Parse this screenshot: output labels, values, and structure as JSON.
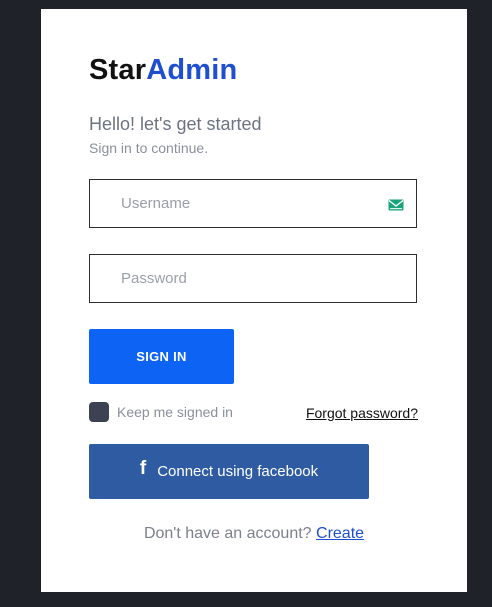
{
  "brand": {
    "part1": "Star",
    "part2": "Admin",
    "accent_color": "#1f4fd1"
  },
  "heading": {
    "greeting": "Hello! let's get started",
    "subtitle": "Sign in to continue."
  },
  "form": {
    "username": {
      "placeholder": "Username",
      "value": "",
      "icon": "mail-icon"
    },
    "password": {
      "placeholder": "Password",
      "value": ""
    },
    "signin_label": "SIGN IN",
    "signin_color": "#0d63f3",
    "keep_signed_in_label": "Keep me signed in",
    "keep_signed_in_checked": false,
    "forgot_label": "Forgot password?"
  },
  "facebook": {
    "icon": "f",
    "label": "Connect using facebook",
    "color": "#2e5ba1"
  },
  "footer": {
    "prompt": "Don't have an account?",
    "create_label": "Create"
  }
}
